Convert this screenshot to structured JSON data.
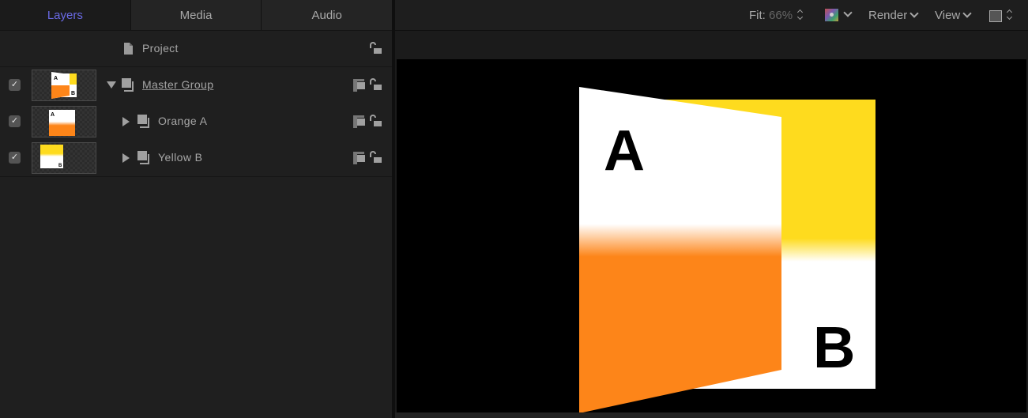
{
  "tabs": [
    {
      "label": "Layers",
      "active": true
    },
    {
      "label": "Media",
      "active": false
    },
    {
      "label": "Audio",
      "active": false
    }
  ],
  "project": {
    "label": "Project",
    "icon": "document-icon",
    "locked": false
  },
  "layers": [
    {
      "label": "Master Group",
      "checked": true,
      "expanded": true,
      "indent": 0,
      "selected_style": "underlined",
      "thumbnail": "master-group-preview"
    },
    {
      "label": "Orange A",
      "checked": true,
      "expanded": false,
      "indent": 1,
      "thumbnail": "orange-a-preview"
    },
    {
      "label": "Yellow B",
      "checked": true,
      "expanded": false,
      "indent": 1,
      "thumbnail": "yellow-b-preview"
    }
  ],
  "toolbar": {
    "fit_label": "Fit:",
    "fit_value": "66%",
    "color_channel_icon": "color-channels-icon",
    "render_label": "Render",
    "view_label": "View",
    "layout_icon": "viewer-layout-icon"
  },
  "canvas": {
    "letter_a": "A",
    "letter_b": "B",
    "colors": {
      "orange": "#fd8519",
      "yellow": "#fedb1e",
      "white": "#ffffff",
      "background": "#000000"
    }
  },
  "colors": {
    "accent": "#6a6ae6",
    "panel": "#1f1f1f",
    "text": "#a6a6a6"
  }
}
